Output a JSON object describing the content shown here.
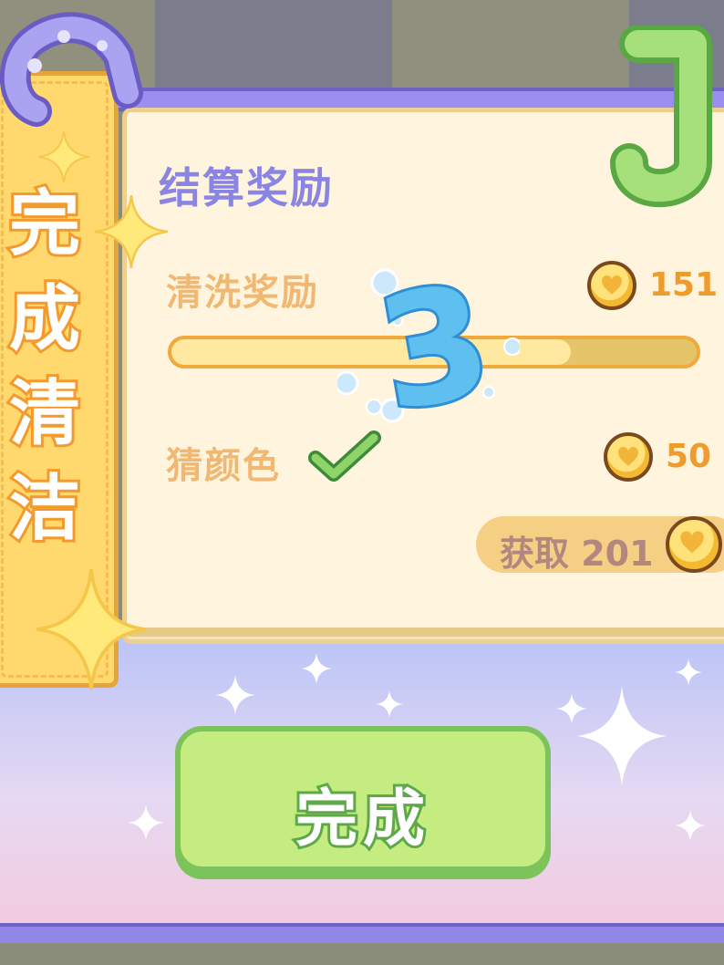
{
  "side_tag": {
    "chars": [
      "完",
      "成",
      "清",
      "洁"
    ]
  },
  "panel": {
    "title": "结算奖励",
    "rows": [
      {
        "label": "清洗奖励",
        "amount": "151",
        "progress_fraction": 0.76
      },
      {
        "label": "猜颜色",
        "amount": "50",
        "completed": true
      }
    ],
    "claim": {
      "label": "获取 201"
    }
  },
  "combo": {
    "text": "3"
  },
  "done_button": {
    "label": "完成"
  },
  "icons": [
    "coin-icon",
    "heart-icon",
    "check-icon",
    "sparkle-icon"
  ],
  "colors": {
    "accent_purple": "#8a84e3",
    "label_orange": "#f1b874",
    "amount_orange": "#ef9c2e",
    "button_green": "#c5ec80"
  }
}
